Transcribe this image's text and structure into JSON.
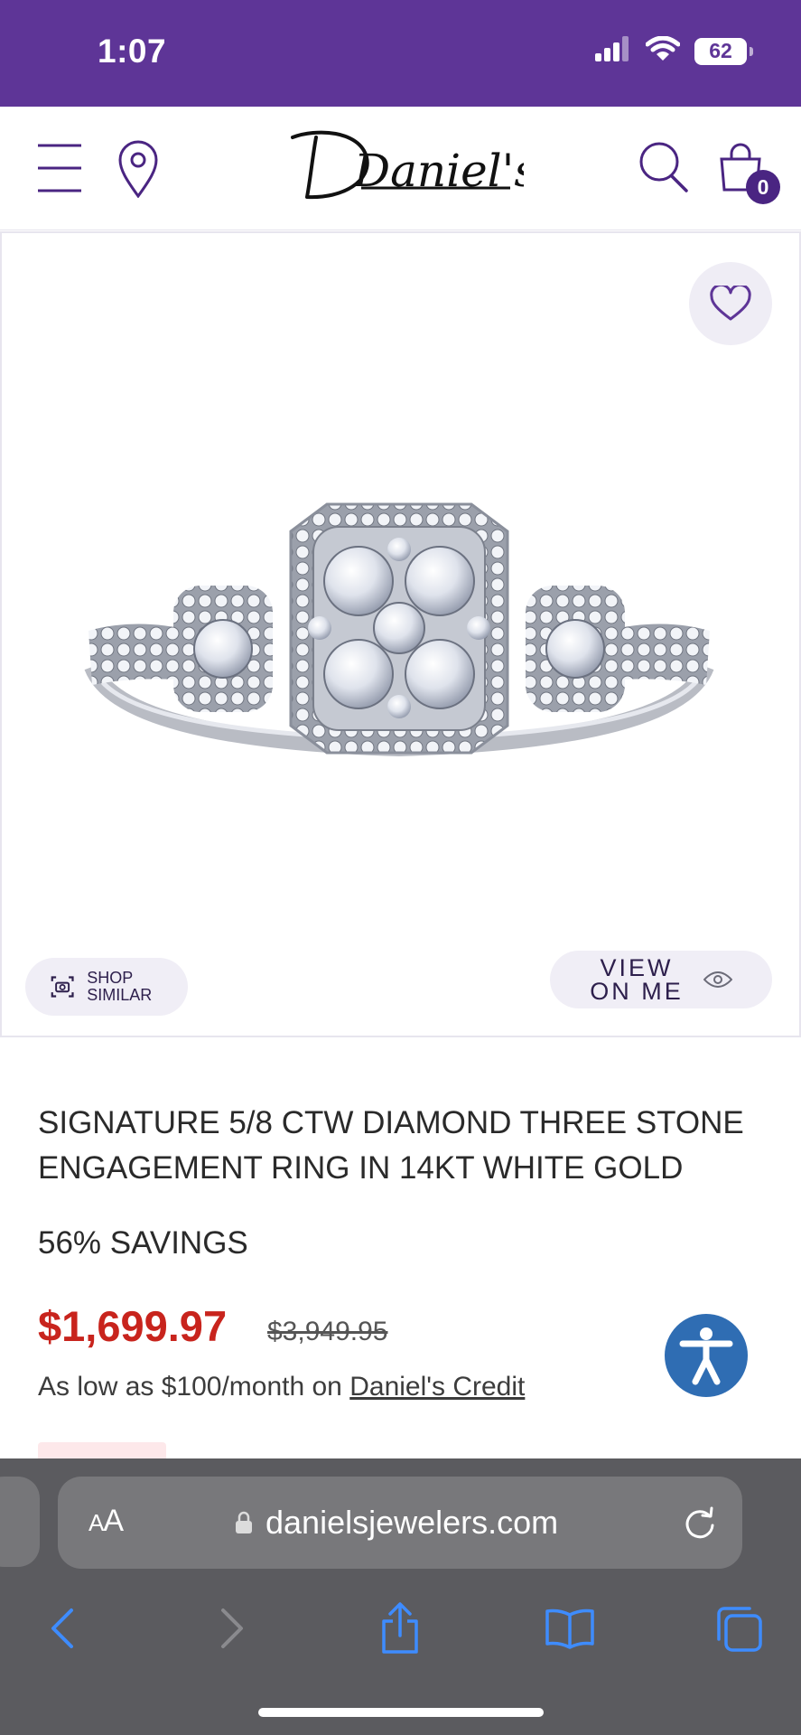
{
  "status_bar": {
    "time": "1:07",
    "battery": "62",
    "icons": [
      "signal-icon",
      "wifi-icon",
      "battery-icon"
    ]
  },
  "header": {
    "logo_text": "Daniel's",
    "cart_count": "0",
    "icons": [
      "menu-icon",
      "location-pin-icon",
      "search-icon",
      "shopping-bag-icon"
    ]
  },
  "product_media": {
    "shop_similar_label": "SHOP SIMILAR",
    "view_on_me_line1": "VIEW",
    "view_on_me_line2": "ON ME",
    "icons": [
      "heart-icon",
      "camera-icon",
      "eye-icon"
    ]
  },
  "product": {
    "title": "SIGNATURE 5/8 CTW DIAMOND THREE STONE ENGAGEMENT RING IN 14KT WHITE GOLD",
    "savings": "56% SAVINGS",
    "sale_price": "$1,699.97",
    "original_price": "$3,949.95",
    "financing_prefix": "As low as $100/month on ",
    "financing_link": "Daniel's Credit"
  },
  "browser": {
    "aa_small": "A",
    "aa_large": "A",
    "url": "danielsjewelers.com",
    "toolbar_icons": [
      "back-icon",
      "forward-icon",
      "share-icon",
      "bookmarks-icon",
      "tabs-icon"
    ]
  },
  "colors": {
    "brand_purple": "#5e3597",
    "sale_red": "#c8241d",
    "accessibility_blue": "#2f6db3"
  }
}
